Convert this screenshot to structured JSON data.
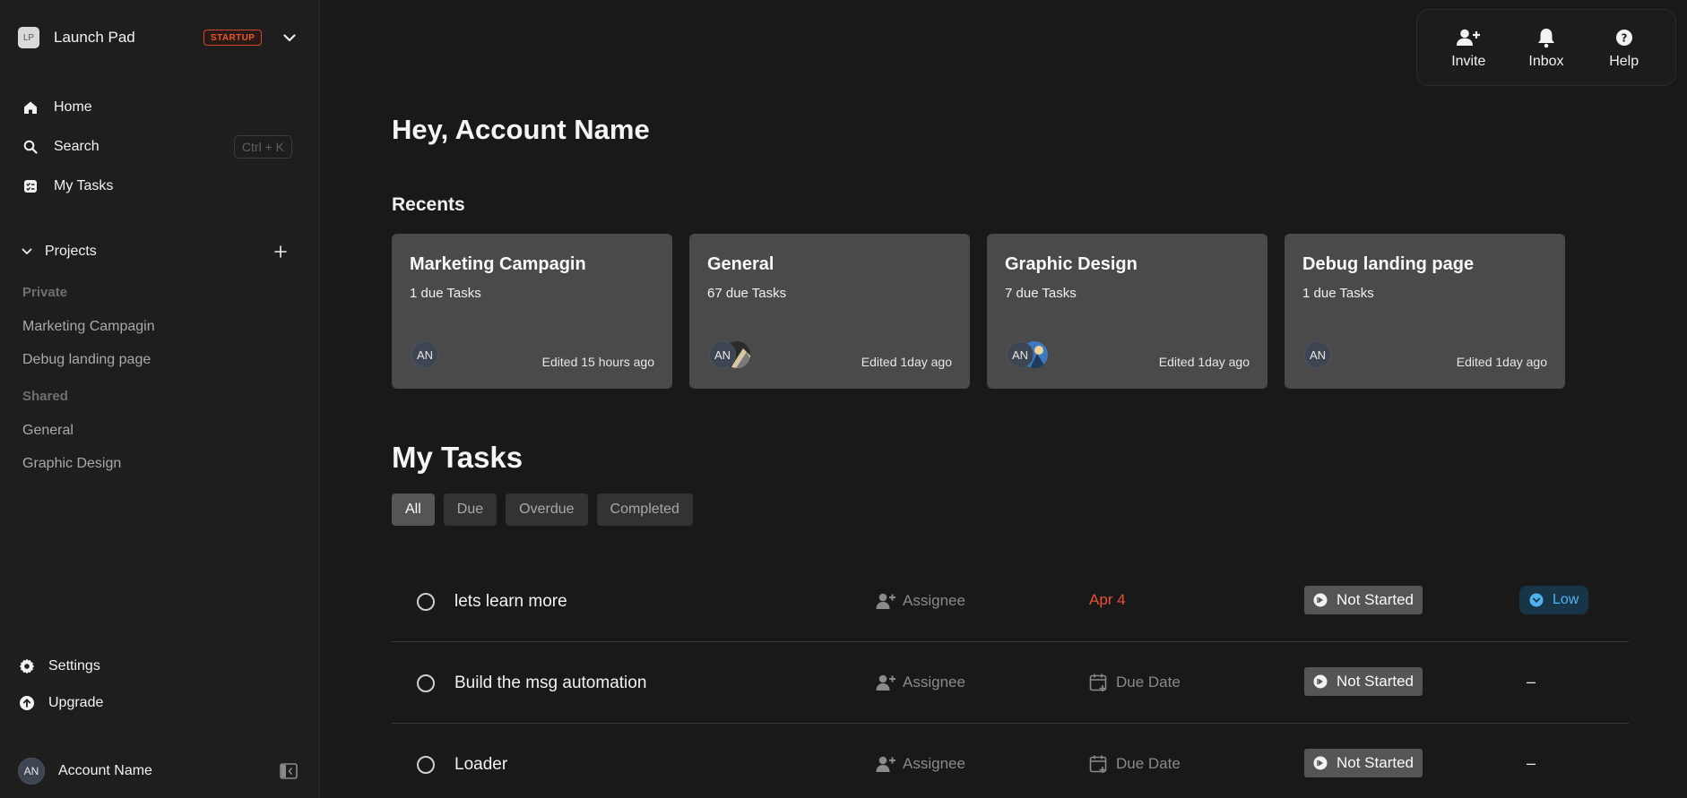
{
  "workspace": {
    "logo": "LP",
    "name": "Launch Pad",
    "badge": "STARTUP"
  },
  "nav": {
    "home": "Home",
    "search": "Search",
    "search_shortcut": "Ctrl + K",
    "my_tasks": "My Tasks"
  },
  "projects": {
    "title": "Projects",
    "private_label": "Private",
    "private": [
      "Marketing Campagin",
      "Debug landing page"
    ],
    "shared_label": "Shared",
    "shared": [
      "General",
      "Graphic Design"
    ]
  },
  "bottom": {
    "settings": "Settings",
    "upgrade": "Upgrade"
  },
  "account": {
    "initials": "AN",
    "name": "Account Name"
  },
  "top_actions": {
    "invite": "Invite",
    "inbox": "Inbox",
    "help": "Help"
  },
  "main": {
    "greeting": "Hey, Account Name",
    "recents_title": "Recents",
    "recents": [
      {
        "title": "Marketing Campagin",
        "due": "1 due Tasks",
        "avatar": "AN",
        "edited": "Edited 15 hours ago"
      },
      {
        "title": "General",
        "due": "67 due Tasks",
        "avatar": "AN",
        "edited": "Edited 1day ago"
      },
      {
        "title": "Graphic Design",
        "due": "7 due Tasks",
        "avatar": "AN",
        "edited": "Edited 1day ago"
      },
      {
        "title": "Debug landing page",
        "due": "1 due Tasks",
        "avatar": "AN",
        "edited": "Edited 1day ago"
      }
    ],
    "tasks_title": "My Tasks",
    "filters": [
      "All",
      "Due",
      "Overdue",
      "Completed"
    ],
    "tasks": [
      {
        "name": "lets learn more",
        "assignee": "Assignee",
        "due": "Apr 4",
        "status": "Not Started",
        "priority": "Low"
      },
      {
        "name": "Build the msg automation",
        "assignee": "Assignee",
        "due": "Due Date",
        "status": "Not Started",
        "priority": "–"
      },
      {
        "name": "Loader",
        "assignee": "Assignee",
        "due": "Due Date",
        "status": "Not Started",
        "priority": "–"
      }
    ]
  },
  "colors": {
    "background": "#191919",
    "sidebar": "#1e1e1e",
    "card": "#4a4a4a",
    "badge": "#e7592f",
    "overdue": "#e8503a",
    "priority_low": "#4fb3ef"
  }
}
